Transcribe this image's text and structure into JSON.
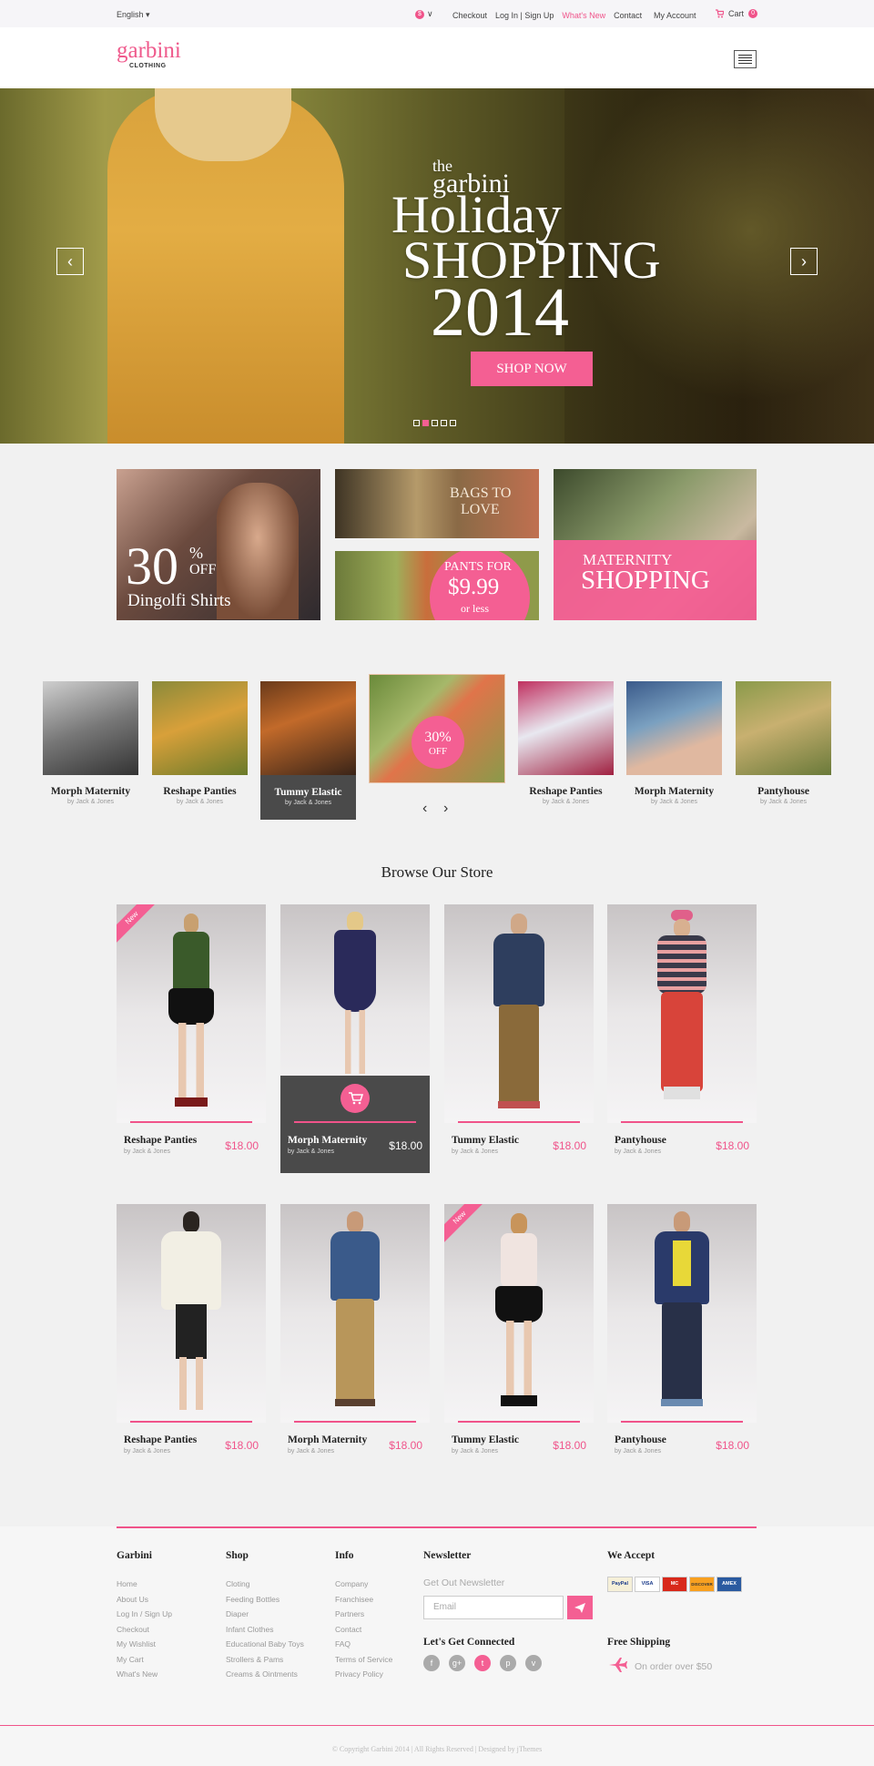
{
  "topbar": {
    "language": "English",
    "currency_symbol": "$",
    "links": [
      "Checkout",
      "Log In | Sign Up",
      "What's New",
      "Contact"
    ],
    "account": "My Account",
    "cart_label": "Cart",
    "cart_count": "0"
  },
  "header": {
    "logo": "garbini",
    "logo_sub": "CLOTHING"
  },
  "hero": {
    "line1": "the",
    "line2": "garbini",
    "line3": "Holiday",
    "line4": "SHOPPING",
    "line5": "2014",
    "cta": "SHOP NOW",
    "prev": "‹",
    "next": "›"
  },
  "banners": {
    "b1_big": "30",
    "b1_pct": "%",
    "b1_off": "OFF",
    "b1_name": "Dingolfi Shirts",
    "b2_text1": "BAGS TO",
    "b2_text2": "LOVE",
    "b3_text1": "PANTS FOR",
    "b3_price": "$9.99",
    "b3_text2": "or less",
    "b4_text1": "MATERNITY",
    "b4_text2": "SHOPPING"
  },
  "carousel": {
    "items": [
      {
        "name": "Morph Maternity",
        "by": "by Jack & Jones"
      },
      {
        "name": "Reshape Panties",
        "by": "by Jack & Jones"
      },
      {
        "name": "Tummy Elastic",
        "by": "by Jack & Jones"
      },
      {
        "name": "Reshape Panties",
        "by": "by Jack & Jones"
      },
      {
        "name": "Morph Maternity",
        "by": "by Jack & Jones"
      },
      {
        "name": "Pantyhouse",
        "by": "by Jack & Jones"
      }
    ],
    "promo_big": "30%",
    "promo_small": "OFF",
    "prev": "‹",
    "next": "›"
  },
  "store": {
    "title": "Browse Our Store",
    "new_label": "New",
    "products": [
      {
        "name": "Reshape Panties",
        "by": "by Jack & Jones",
        "price": "$18.00"
      },
      {
        "name": "Morph Maternity",
        "by": "by Jack & Jones",
        "price": "$18.00"
      },
      {
        "name": "Tummy Elastic",
        "by": "by Jack & Jones",
        "price": "$18.00"
      },
      {
        "name": "Pantyhouse",
        "by": "by Jack & Jones",
        "price": "$18.00"
      },
      {
        "name": "Reshape Panties",
        "by": "by Jack & Jones",
        "price": "$18.00"
      },
      {
        "name": "Morph Maternity",
        "by": "by Jack & Jones",
        "price": "$18.00"
      },
      {
        "name": "Tummy Elastic",
        "by": "by Jack & Jones",
        "price": "$18.00"
      },
      {
        "name": "Pantyhouse",
        "by": "by Jack & Jones",
        "price": "$18.00"
      }
    ]
  },
  "footer": {
    "garbini": {
      "title": "Garbini",
      "links": [
        "Home",
        "About Us",
        "Log In / Sign Up",
        "Checkout",
        "My Wishlist",
        "My Cart",
        "What's New"
      ]
    },
    "shop": {
      "title": "Shop",
      "links": [
        "Cloting",
        "Feeding Bottles",
        "Diaper",
        "Infant Clothes",
        "Educational Baby Toys",
        "Strollers & Pams",
        "Creams & Ointments"
      ]
    },
    "info": {
      "title": "Info",
      "links": [
        "Company",
        "Franchisee",
        "Partners",
        "Contact",
        "FAQ",
        "Terms of Service",
        "Privacy Policy"
      ]
    },
    "newsletter": {
      "title": "Newsletter",
      "subtitle": "Get Out Newsletter",
      "placeholder": "Email"
    },
    "connected": "Let's Get  Connected",
    "social": [
      "f",
      "g+",
      "t",
      "p",
      "v"
    ],
    "accept": "We Accept",
    "cards": [
      "PayPal",
      "VISA",
      "MC",
      "DISCOVER",
      "AMEX"
    ],
    "shipping_title": "Free Shipping",
    "shipping_text": "On order over $50",
    "copyright": "© Copyright Garbini 2014 | All Rights Reserved | Designed by jThemes"
  },
  "colors": {
    "accent": "#f0538a",
    "dark": "#4a4a4a"
  }
}
